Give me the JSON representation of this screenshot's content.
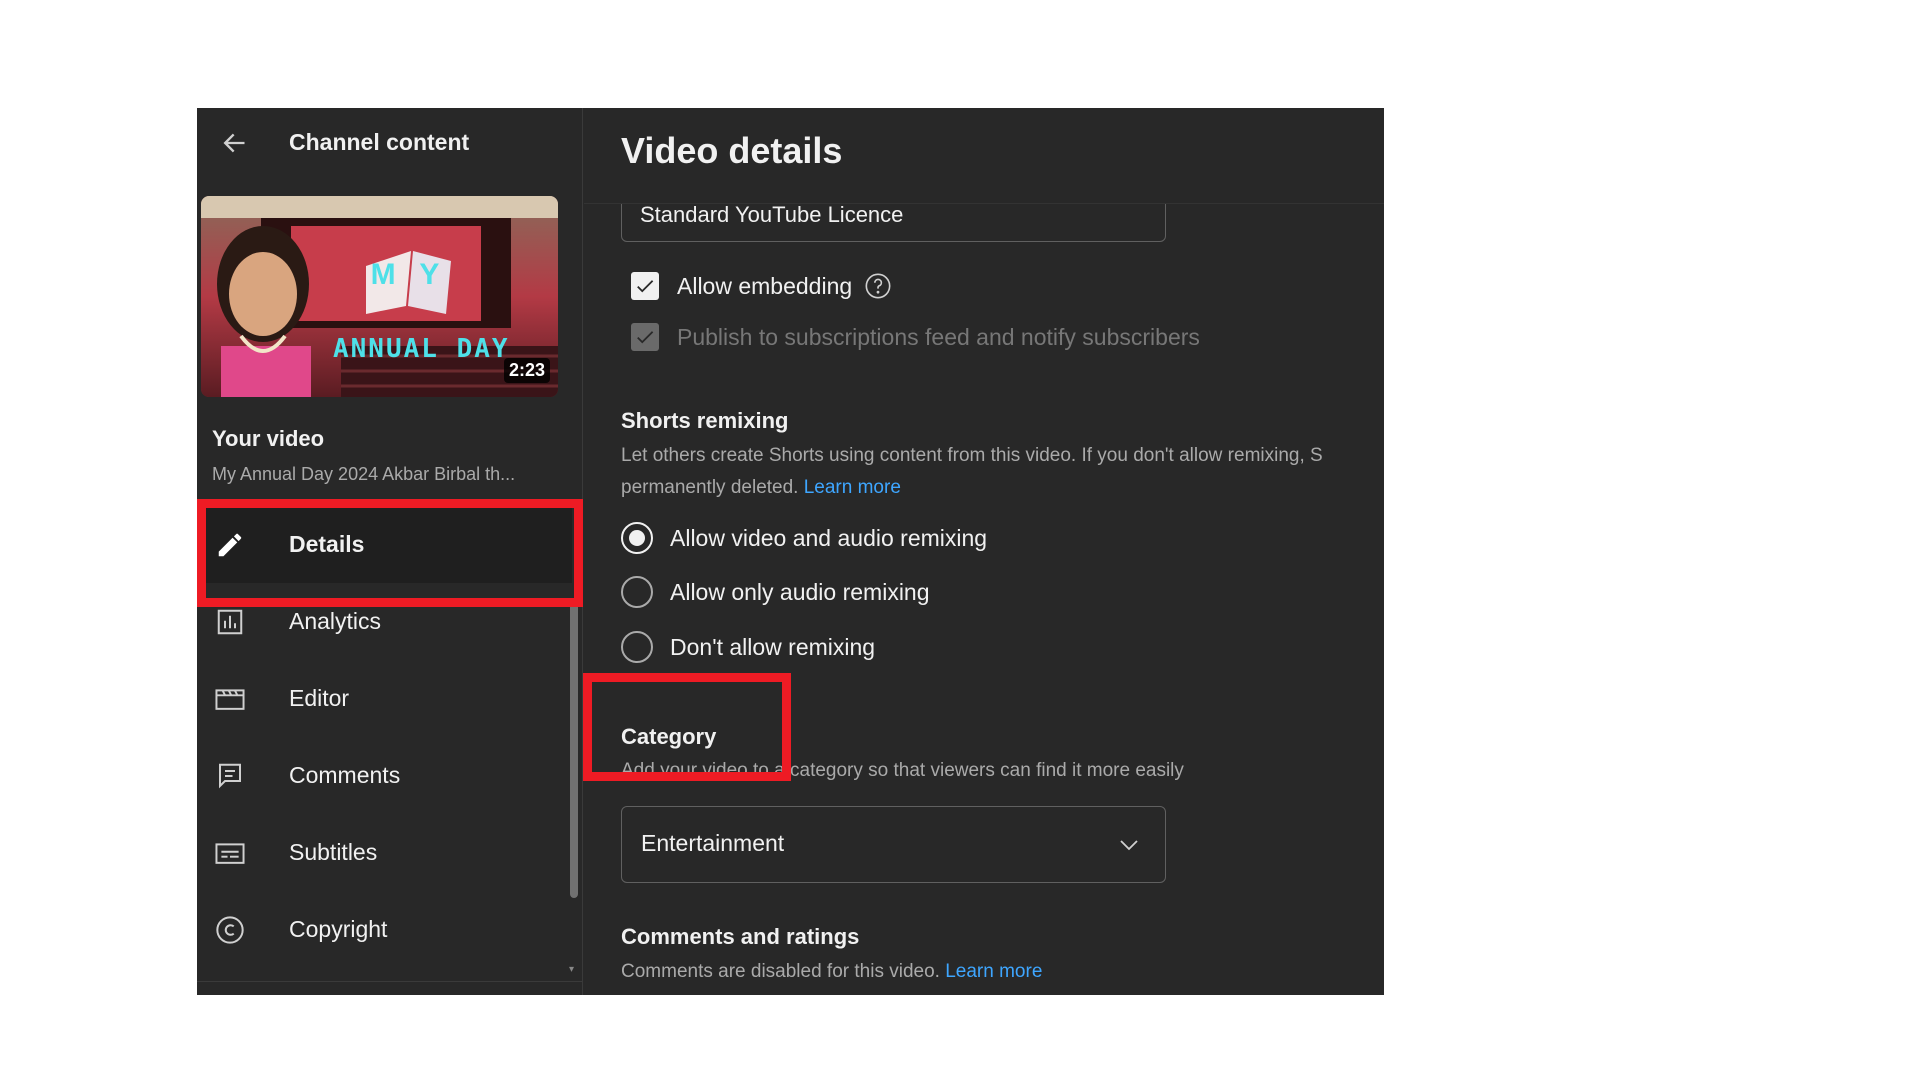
{
  "sidebar": {
    "back_icon": "arrow-left-icon",
    "title": "Channel content",
    "thumbnail": {
      "overlay_text_my": "M Y",
      "overlay_text": "ANNUAL DAY",
      "duration": "2:23"
    },
    "your_video_label": "Your video",
    "video_title": "My Annual Day 2024 Akbar Birbal th...",
    "nav": [
      {
        "label": "Details",
        "icon": "pencil-icon",
        "active": true
      },
      {
        "label": "Analytics",
        "icon": "analytics-icon",
        "active": false
      },
      {
        "label": "Editor",
        "icon": "clapperboard-icon",
        "active": false
      },
      {
        "label": "Comments",
        "icon": "comments-icon",
        "active": false
      },
      {
        "label": "Subtitles",
        "icon": "subtitles-icon",
        "active": false
      },
      {
        "label": "Copyright",
        "icon": "copyright-icon",
        "active": false
      }
    ]
  },
  "main": {
    "title": "Video details",
    "licence_value": "Standard YouTube Licence",
    "allow_embedding": {
      "label": "Allow embedding",
      "checked": true
    },
    "publish_subscriptions": {
      "label": "Publish to subscriptions feed and notify subscribers",
      "checked": true,
      "disabled": true
    },
    "shorts_remixing": {
      "title": "Shorts remixing",
      "desc_line1": "Let others create Shorts using content from this video. If you don't allow remixing, S",
      "desc_line2": "permanently deleted.",
      "learn_more": "Learn more",
      "options": [
        {
          "label": "Allow video and audio remixing",
          "selected": true
        },
        {
          "label": "Allow only audio remixing",
          "selected": false
        },
        {
          "label": "Don't allow remixing",
          "selected": false
        }
      ]
    },
    "category": {
      "title": "Category",
      "desc_prefix": "Add your video to",
      "desc_suffix": "a category so that viewers can find it more easily",
      "selected": "Entertainment"
    },
    "comments_ratings": {
      "title": "Comments and ratings",
      "desc": "Comments are disabled for this video.",
      "learn_more": "Learn more"
    }
  },
  "colors": {
    "background": "#282828",
    "text_primary": "#f1f1f1",
    "text_secondary": "#aaaaaa",
    "link": "#3ea6ff",
    "highlight": "#ee1b24"
  }
}
